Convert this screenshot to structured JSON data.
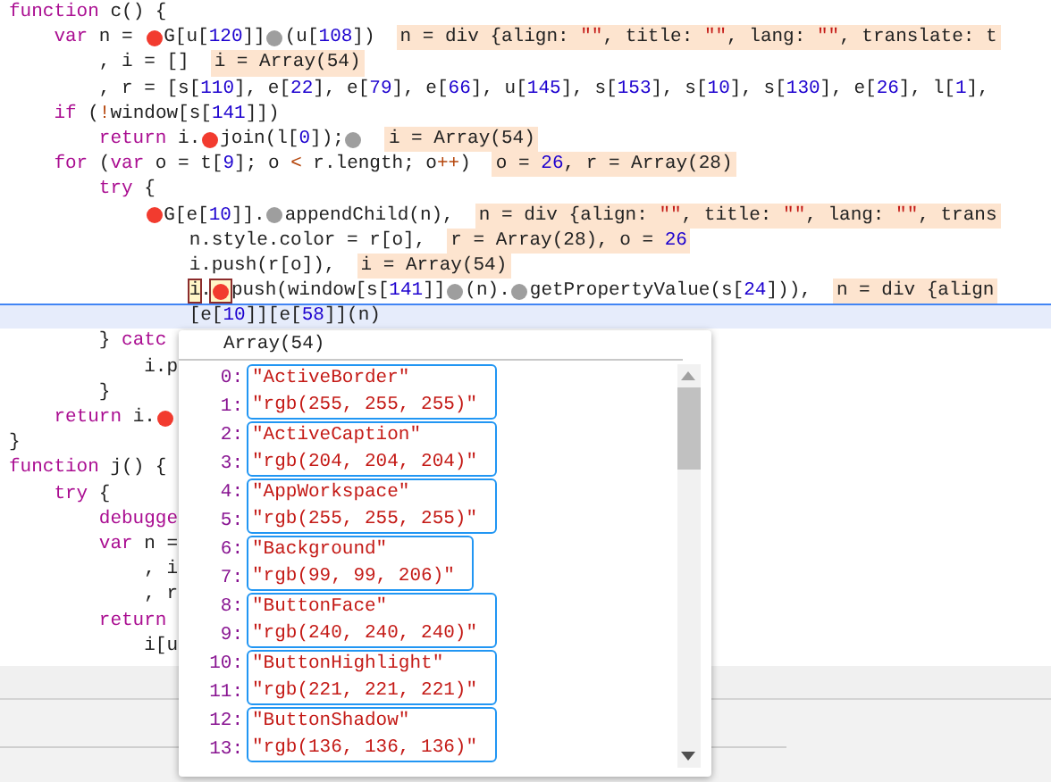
{
  "editor": {
    "lines": [
      {
        "current": false,
        "segments": [
          {
            "kind": "code",
            "parts": [
              {
                "kind": "kw",
                "text": "function"
              },
              {
                "kind": "plain",
                "text": " c() {"
              }
            ]
          }
        ],
        "children": [
          {
            "current": false,
            "segments": [
              {
                "kind": "code",
                "parts": [
                  {
                    "kind": "kw",
                    "text": "var"
                  },
                  {
                    "kind": "plain",
                    "text": " n = "
                  }
                ]
              },
              {
                "kind": "breakpoint",
                "enabled": true,
                "boxed": false
              },
              {
                "kind": "code",
                "parts": [
                  {
                    "kind": "plain",
                    "text": "G[u["
                  },
                  {
                    "kind": "num",
                    "text": "120"
                  },
                  {
                    "kind": "plain",
                    "text": "]]"
                  }
                ]
              },
              {
                "kind": "breakpoint",
                "enabled": false,
                "boxed": false
              },
              {
                "kind": "code",
                "parts": [
                  {
                    "kind": "plain",
                    "text": "(u["
                  },
                  {
                    "kind": "num",
                    "text": "108"
                  },
                  {
                    "kind": "plain",
                    "text": "])"
                  }
                ]
              },
              {
                "kind": "value",
                "parts": [
                  {
                    "kind": "plain",
                    "text": "n = div {align: "
                  },
                  {
                    "kind": "str",
                    "text": "\"\""
                  },
                  {
                    "kind": "plain",
                    "text": ", title: "
                  },
                  {
                    "kind": "str",
                    "text": "\"\""
                  },
                  {
                    "kind": "plain",
                    "text": ", lang: "
                  },
                  {
                    "kind": "str",
                    "text": "\"\""
                  },
                  {
                    "kind": "plain",
                    "text": ", translate: t"
                  }
                ]
              }
            ],
            "children": [
              {
                "current": false,
                "segments": [
                  {
                    "kind": "code",
                    "parts": [
                      {
                        "kind": "plain",
                        "text": ", i = []"
                      }
                    ]
                  },
                  {
                    "kind": "value",
                    "parts": [
                      {
                        "kind": "plain",
                        "text": "i = Array(54)"
                      }
                    ]
                  }
                ]
              },
              {
                "current": false,
                "segments": [
                  {
                    "kind": "code",
                    "parts": [
                      {
                        "kind": "plain",
                        "text": ", r = [s["
                      },
                      {
                        "kind": "num",
                        "text": "110"
                      },
                      {
                        "kind": "plain",
                        "text": "], e["
                      },
                      {
                        "kind": "num",
                        "text": "22"
                      },
                      {
                        "kind": "plain",
                        "text": "], e["
                      },
                      {
                        "kind": "num",
                        "text": "79"
                      },
                      {
                        "kind": "plain",
                        "text": "], e["
                      },
                      {
                        "kind": "num",
                        "text": "66"
                      },
                      {
                        "kind": "plain",
                        "text": "], u["
                      },
                      {
                        "kind": "num",
                        "text": "145"
                      },
                      {
                        "kind": "plain",
                        "text": "], s["
                      },
                      {
                        "kind": "num",
                        "text": "153"
                      },
                      {
                        "kind": "plain",
                        "text": "], s["
                      },
                      {
                        "kind": "num",
                        "text": "10"
                      },
                      {
                        "kind": "plain",
                        "text": "], s["
                      },
                      {
                        "kind": "num",
                        "text": "130"
                      },
                      {
                        "kind": "plain",
                        "text": "], e["
                      },
                      {
                        "kind": "num",
                        "text": "26"
                      },
                      {
                        "kind": "plain",
                        "text": "], l["
                      },
                      {
                        "kind": "num",
                        "text": "1"
                      },
                      {
                        "kind": "plain",
                        "text": "],"
                      }
                    ]
                  }
                ]
              }
            ]
          },
          {
            "current": false,
            "segments": [
              {
                "kind": "code",
                "parts": [
                  {
                    "kind": "kw",
                    "text": "if"
                  },
                  {
                    "kind": "plain",
                    "text": " ("
                  },
                  {
                    "kind": "op",
                    "text": "!"
                  },
                  {
                    "kind": "plain",
                    "text": "window[s["
                  },
                  {
                    "kind": "num",
                    "text": "141"
                  },
                  {
                    "kind": "plain",
                    "text": "]])"
                  }
                ]
              }
            ],
            "children": [
              {
                "current": false,
                "segments": [
                  {
                    "kind": "code",
                    "parts": [
                      {
                        "kind": "kw",
                        "text": "return"
                      },
                      {
                        "kind": "plain",
                        "text": " i."
                      }
                    ]
                  },
                  {
                    "kind": "breakpoint",
                    "enabled": true,
                    "boxed": false
                  },
                  {
                    "kind": "code",
                    "parts": [
                      {
                        "kind": "plain",
                        "text": "join(l["
                      },
                      {
                        "kind": "num",
                        "text": "0"
                      },
                      {
                        "kind": "plain",
                        "text": "]);"
                      }
                    ]
                  },
                  {
                    "kind": "breakpoint",
                    "enabled": false,
                    "boxed": false
                  },
                  {
                    "kind": "value",
                    "parts": [
                      {
                        "kind": "plain",
                        "text": "i = Array(54)"
                      }
                    ]
                  }
                ]
              }
            ]
          },
          {
            "current": false,
            "segments": [
              {
                "kind": "code",
                "parts": [
                  {
                    "kind": "kw",
                    "text": "for"
                  },
                  {
                    "kind": "plain",
                    "text": " ("
                  },
                  {
                    "kind": "kw",
                    "text": "var"
                  },
                  {
                    "kind": "plain",
                    "text": " o = t["
                  },
                  {
                    "kind": "num",
                    "text": "9"
                  },
                  {
                    "kind": "plain",
                    "text": "]; o "
                  },
                  {
                    "kind": "op",
                    "text": "<"
                  },
                  {
                    "kind": "plain",
                    "text": " r.length; o"
                  },
                  {
                    "kind": "op",
                    "text": "++"
                  },
                  {
                    "kind": "plain",
                    "text": ")"
                  }
                ]
              },
              {
                "kind": "value",
                "parts": [
                  {
                    "kind": "plain",
                    "text": "o = "
                  },
                  {
                    "kind": "num",
                    "text": "26"
                  },
                  {
                    "kind": "plain",
                    "text": ", r = Array(28)"
                  }
                ]
              }
            ],
            "children": [
              {
                "current": false,
                "segments": [
                  {
                    "kind": "code",
                    "parts": [
                      {
                        "kind": "kw",
                        "text": "try"
                      },
                      {
                        "kind": "plain",
                        "text": " {"
                      }
                    ]
                  }
                ],
                "children": [
                  {
                    "current": false,
                    "segments": [
                      {
                        "kind": "breakpoint",
                        "enabled": true,
                        "boxed": false
                      },
                      {
                        "kind": "code",
                        "parts": [
                          {
                            "kind": "plain",
                            "text": "G[e["
                          },
                          {
                            "kind": "num",
                            "text": "10"
                          },
                          {
                            "kind": "plain",
                            "text": "]]."
                          }
                        ]
                      },
                      {
                        "kind": "breakpoint",
                        "enabled": false,
                        "boxed": false
                      },
                      {
                        "kind": "code",
                        "parts": [
                          {
                            "kind": "plain",
                            "text": "appendChild(n),"
                          }
                        ]
                      },
                      {
                        "kind": "value",
                        "parts": [
                          {
                            "kind": "plain",
                            "text": "n = div {align: "
                          },
                          {
                            "kind": "str",
                            "text": "\"\""
                          },
                          {
                            "kind": "plain",
                            "text": ", title: "
                          },
                          {
                            "kind": "str",
                            "text": "\"\""
                          },
                          {
                            "kind": "plain",
                            "text": ", lang: "
                          },
                          {
                            "kind": "str",
                            "text": "\"\""
                          },
                          {
                            "kind": "plain",
                            "text": ", trans"
                          }
                        ]
                      }
                    ],
                    "children": [
                      {
                        "current": false,
                        "segments": [
                          {
                            "kind": "code",
                            "parts": [
                              {
                                "kind": "plain",
                                "text": "n.style.color = r[o],"
                              }
                            ]
                          },
                          {
                            "kind": "value",
                            "parts": [
                              {
                                "kind": "plain",
                                "text": "r = Array(28), o = "
                              },
                              {
                                "kind": "num",
                                "text": "26"
                              }
                            ]
                          }
                        ]
                      },
                      {
                        "current": false,
                        "segments": [
                          {
                            "kind": "code",
                            "parts": [
                              {
                                "kind": "plain",
                                "text": "i.push(r[o]),"
                              }
                            ]
                          },
                          {
                            "kind": "value",
                            "parts": [
                              {
                                "kind": "plain",
                                "text": "i = Array(54)"
                              }
                            ]
                          }
                        ]
                      },
                      {
                        "current": false,
                        "segments": [
                          {
                            "kind": "code",
                            "parts": [
                              {
                                "kind": "plain",
                                "text": "i",
                                "boxed": true
                              },
                              {
                                "kind": "plain",
                                "text": "."
                              }
                            ]
                          },
                          {
                            "kind": "breakpoint",
                            "enabled": true,
                            "boxed": true
                          },
                          {
                            "kind": "code",
                            "parts": [
                              {
                                "kind": "plain",
                                "text": "push(window[s["
                              },
                              {
                                "kind": "num",
                                "text": "141"
                              },
                              {
                                "kind": "plain",
                                "text": "]]"
                              }
                            ]
                          },
                          {
                            "kind": "breakpoint",
                            "enabled": false,
                            "boxed": false
                          },
                          {
                            "kind": "code",
                            "parts": [
                              {
                                "kind": "plain",
                                "text": "(n)."
                              }
                            ]
                          },
                          {
                            "kind": "breakpoint",
                            "enabled": false,
                            "boxed": false
                          },
                          {
                            "kind": "code",
                            "parts": [
                              {
                                "kind": "plain",
                                "text": "getPropertyValue(s["
                              },
                              {
                                "kind": "num",
                                "text": "24"
                              },
                              {
                                "kind": "plain",
                                "text": "])),"
                              }
                            ]
                          },
                          {
                            "kind": "value",
                            "parts": [
                              {
                                "kind": "plain",
                                "text": "n = div {align"
                              }
                            ]
                          }
                        ]
                      },
                      {
                        "current": true,
                        "segments": [
                          {
                            "kind": "code",
                            "parts": [
                              {
                                "kind": "plain",
                                "text": "[e["
                              },
                              {
                                "kind": "num",
                                "text": "10"
                              },
                              {
                                "kind": "plain",
                                "text": "]][e["
                              },
                              {
                                "kind": "num",
                                "text": "58"
                              },
                              {
                                "kind": "plain",
                                "text": "]](n)"
                              }
                            ]
                          }
                        ]
                      }
                    ]
                  }
                ]
              },
              {
                "current": false,
                "segments": [
                  {
                    "kind": "code",
                    "parts": [
                      {
                        "kind": "plain",
                        "text": "} "
                      },
                      {
                        "kind": "kw",
                        "text": "catc"
                      }
                    ]
                  }
                ],
                "children": [
                  {
                    "current": false,
                    "segments": [
                      {
                        "kind": "code",
                        "parts": [
                          {
                            "kind": "plain",
                            "text": "i.p"
                          }
                        ]
                      }
                    ]
                  }
                ]
              },
              {
                "current": false,
                "segments": [
                  {
                    "kind": "code",
                    "parts": [
                      {
                        "kind": "plain",
                        "text": "}"
                      }
                    ]
                  }
                ]
              }
            ]
          },
          {
            "current": false,
            "segments": [
              {
                "kind": "code",
                "parts": [
                  {
                    "kind": "kw",
                    "text": "return"
                  },
                  {
                    "kind": "plain",
                    "text": " i."
                  }
                ]
              },
              {
                "kind": "breakpoint",
                "enabled": true,
                "boxed": false
              }
            ]
          }
        ]
      },
      {
        "current": false,
        "segments": [
          {
            "kind": "code",
            "parts": [
              {
                "kind": "plain",
                "text": "}"
              }
            ]
          }
        ]
      },
      {
        "current": false,
        "segments": [
          {
            "kind": "code",
            "parts": [
              {
                "kind": "kw",
                "text": "function"
              },
              {
                "kind": "plain",
                "text": " j() {"
              }
            ]
          }
        ],
        "children": [
          {
            "current": false,
            "segments": [
              {
                "kind": "code",
                "parts": [
                  {
                    "kind": "kw",
                    "text": "try"
                  },
                  {
                    "kind": "plain",
                    "text": " {"
                  }
                ]
              }
            ],
            "children": [
              {
                "current": false,
                "segments": [
                  {
                    "kind": "code",
                    "parts": [
                      {
                        "kind": "kw",
                        "text": "debugge"
                      }
                    ]
                  }
                ]
              },
              {
                "current": false,
                "segments": [
                  {
                    "kind": "code",
                    "parts": [
                      {
                        "kind": "kw",
                        "text": "var"
                      },
                      {
                        "kind": "plain",
                        "text": " n ="
                      }
                    ]
                  }
                ],
                "children": [
                  {
                    "current": false,
                    "segments": [
                      {
                        "kind": "code",
                        "parts": [
                          {
                            "kind": "plain",
                            "text": ", i"
                          }
                        ]
                      }
                    ]
                  },
                  {
                    "current": false,
                    "segments": [
                      {
                        "kind": "code",
                        "parts": [
                          {
                            "kind": "plain",
                            "text": ", r"
                          }
                        ]
                      }
                    ]
                  }
                ]
              },
              {
                "current": false,
                "segments": [
                  {
                    "kind": "code",
                    "parts": [
                      {
                        "kind": "kw",
                        "text": "return"
                      }
                    ]
                  }
                ],
                "children": [
                  {
                    "current": false,
                    "segments": [
                      {
                        "kind": "code",
                        "parts": [
                          {
                            "kind": "plain",
                            "text": "i[u"
                          }
                        ]
                      }
                    ]
                  }
                ]
              }
            ]
          }
        ]
      }
    ]
  },
  "popover": {
    "title": "Array(54)",
    "groups": [
      {
        "entries": [
          {
            "index": "0:",
            "value": "\"ActiveBorder\""
          },
          {
            "index": "1:",
            "value": "\"rgb(255, 255, 255)\""
          }
        ]
      },
      {
        "entries": [
          {
            "index": "2:",
            "value": "\"ActiveCaption\""
          },
          {
            "index": "3:",
            "value": "\"rgb(204, 204, 204)\""
          }
        ]
      },
      {
        "entries": [
          {
            "index": "4:",
            "value": "\"AppWorkspace\""
          },
          {
            "index": "5:",
            "value": "\"rgb(255, 255, 255)\""
          }
        ]
      },
      {
        "entries": [
          {
            "index": "6:",
            "value": "\"Background\""
          },
          {
            "index": "7:",
            "value": "\"rgb(99, 99, 206)\""
          }
        ]
      },
      {
        "entries": [
          {
            "index": "8:",
            "value": "\"ButtonFace\""
          },
          {
            "index": "9:",
            "value": "\"rgb(240, 240, 240)\""
          }
        ]
      },
      {
        "entries": [
          {
            "index": "10:",
            "value": "\"ButtonHighlight\""
          },
          {
            "index": "11:",
            "value": "\"rgb(221, 221, 221)\""
          }
        ]
      },
      {
        "entries": [
          {
            "index": "12:",
            "value": "\"ButtonShadow\""
          },
          {
            "index": "13:",
            "value": "\"rgb(136, 136, 136)\""
          }
        ]
      }
    ]
  }
}
